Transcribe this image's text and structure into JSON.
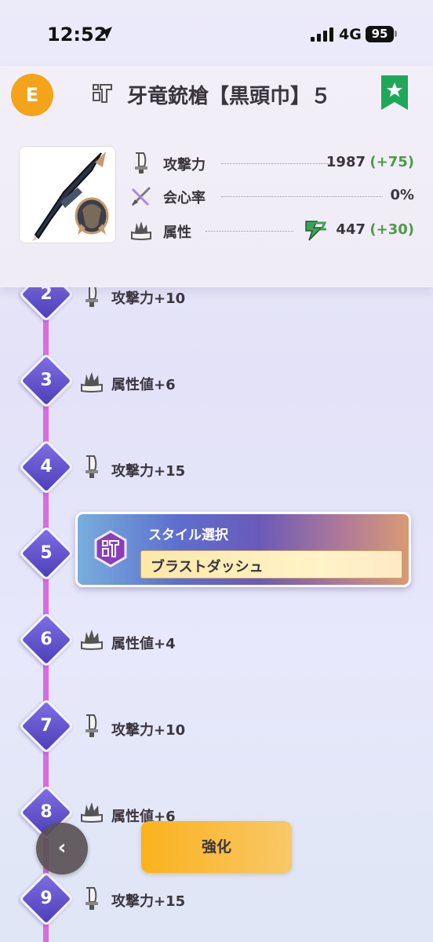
{
  "status_bar": {
    "time": "12:52",
    "network": "4G",
    "battery": "95",
    "location_icon": "location-arrow-icon",
    "signal_icon": "cell-signal-icon"
  },
  "header": {
    "rank": "E",
    "weapon_type_icon": "gunlance-icon",
    "weapon_name": "牙竜銃槍【黒頭巾】５",
    "favorite_icon": "bookmark-star-icon",
    "weapon_image_icon": "weapon-image"
  },
  "stats": [
    {
      "icon": "attack-icon",
      "label": "攻撃力",
      "value": "1987",
      "bonus": "(+75)"
    },
    {
      "icon": "affinity-icon",
      "label": "会心率",
      "value": "0%",
      "bonus": ""
    },
    {
      "icon": "element-icon",
      "label": "属性",
      "value": "447",
      "bonus": "(+30)",
      "element_icon": "thunder-element-icon"
    }
  ],
  "timeline": {
    "steps": [
      {
        "num": "2",
        "icon": "attack-icon",
        "label": "攻撃力+10"
      },
      {
        "num": "3",
        "icon": "element-icon",
        "label": "属性値+6"
      },
      {
        "num": "4",
        "icon": "attack-icon",
        "label": "攻撃力+15"
      },
      {
        "num": "5",
        "icon": "style-icon",
        "label": ""
      },
      {
        "num": "6",
        "icon": "element-icon",
        "label": "属性値+4"
      },
      {
        "num": "7",
        "icon": "attack-icon",
        "label": "攻撃力+10"
      },
      {
        "num": "8",
        "icon": "element-icon",
        "label": "属性値+6"
      },
      {
        "num": "9",
        "icon": "attack-icon",
        "label": "攻撃力+15"
      }
    ],
    "style_select": {
      "title": "スタイル選択",
      "value": "ブラストダッシュ"
    }
  },
  "buttons": {
    "back": "‹",
    "enhance": "強化"
  },
  "colors": {
    "rank_badge": "#f4a31a",
    "timeline_line": "#d66ee0",
    "bonus_green": "#4e9a4a",
    "favorite_green": "#1fa85a",
    "enhance_button": "#fbb21c"
  }
}
